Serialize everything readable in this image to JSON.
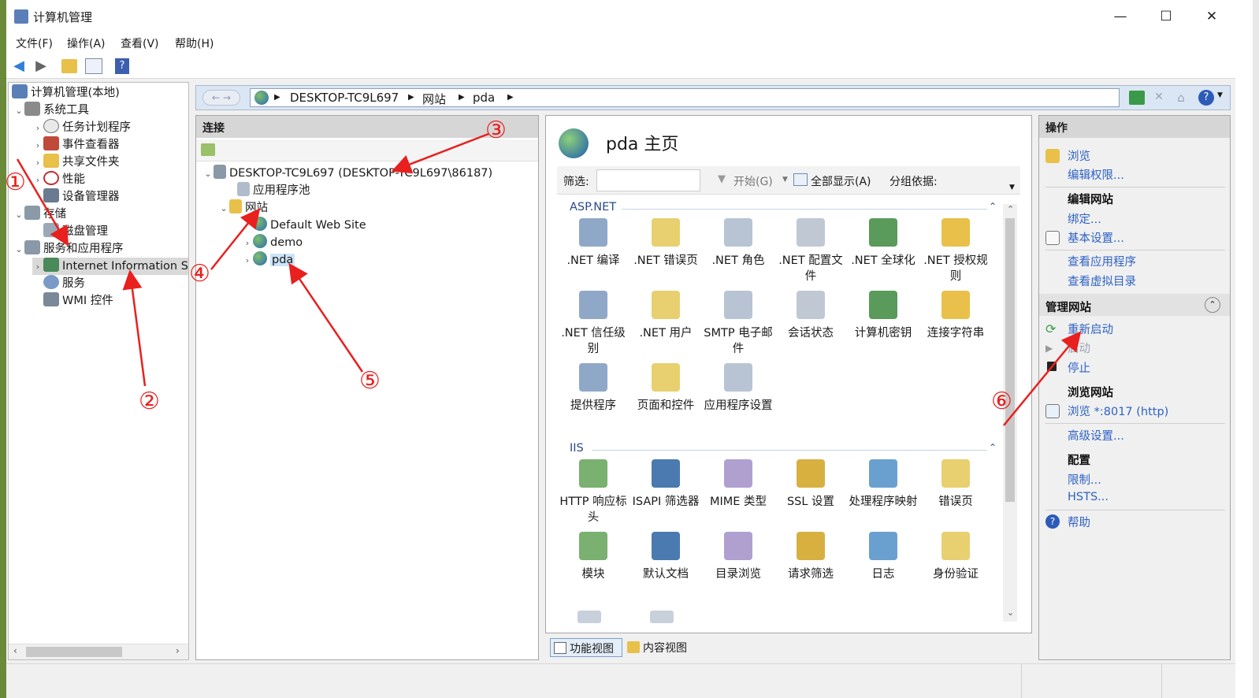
{
  "window": {
    "title": "计算机管理",
    "minimize": "—",
    "maximize": "☐",
    "close": "✕"
  },
  "menu": [
    "文件(F)",
    "操作(A)",
    "查看(V)",
    "帮助(H)"
  ],
  "tree": {
    "root": "计算机管理(本地)",
    "system_tools": "系统工具",
    "task_scheduler": "任务计划程序",
    "event_viewer": "事件查看器",
    "shared_folders": "共享文件夹",
    "performance": "性能",
    "device_manager": "设备管理器",
    "storage": "存储",
    "disk_management": "磁盘管理",
    "services_apps": "服务和应用程序",
    "iis": "Internet Information Se",
    "services": "服务",
    "wmi": "WMI 控件"
  },
  "address": {
    "crumbs": [
      "DESKTOP-TC9L697",
      "网站",
      "pda"
    ]
  },
  "connections": {
    "header": "连接",
    "server": "DESKTOP-TC9L697 (DESKTOP-TC9L697\\86187)",
    "app_pools": "应用程序池",
    "sites": "网站",
    "default_site": "Default Web Site",
    "demo": "demo",
    "pda": "pda"
  },
  "home": {
    "title": "pda 主页",
    "filter_label": "筛选:",
    "start_label": "开始(G)",
    "show_all_label": "全部显示(A)",
    "group_by_label": "分组依据:",
    "sections": {
      "aspnet": "ASP.NET",
      "iis": "IIS"
    },
    "aspnet_features": [
      ".NET 编译",
      ".NET 错误页",
      ".NET 角色",
      ".NET 配置文件",
      ".NET 全球化",
      ".NET 授权规则",
      ".NET 信任级别",
      ".NET 用户",
      "SMTP 电子邮件",
      "会话状态",
      "计算机密钥",
      "连接字符串",
      "提供程序",
      "页面和控件",
      "应用程序设置"
    ],
    "iis_features": [
      "HTTP 响应标头",
      "ISAPI 筛选器",
      "MIME 类型",
      "SSL 设置",
      "处理程序映射",
      "错误页",
      "模块",
      "默认文档",
      "目录浏览",
      "请求筛选",
      "日志",
      "身份验证"
    ]
  },
  "views": {
    "features": "功能视图",
    "content": "内容视图"
  },
  "actions": {
    "header": "操作",
    "browse": "浏览",
    "edit_permissions": "编辑权限...",
    "edit_site": "编辑网站",
    "bindings": "绑定...",
    "basic_settings": "基本设置...",
    "view_apps": "查看应用程序",
    "view_vdirs": "查看虚拟目录",
    "manage_site": "管理网站",
    "restart": "重新启动",
    "start": "启动",
    "stop": "停止",
    "browse_site": "浏览网站",
    "browse_port": "浏览 *:8017 (http)",
    "advanced": "高级设置...",
    "config": "配置",
    "limits": "限制...",
    "hsts": "HSTS...",
    "help": "帮助"
  },
  "annotations": [
    "①",
    "②",
    "③",
    "④",
    "⑤",
    "⑥"
  ],
  "colors": {
    "accent": "#2e62c4",
    "annotation": "#e8201e",
    "selected": "#cce4f7"
  }
}
